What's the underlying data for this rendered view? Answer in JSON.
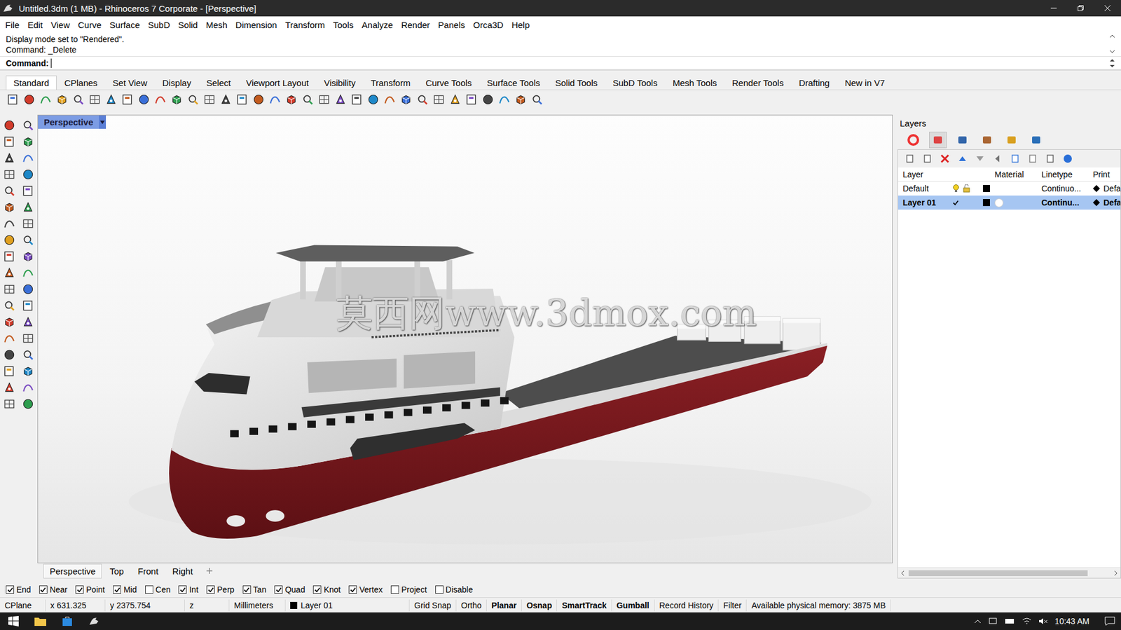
{
  "window": {
    "title": "Untitled.3dm (1 MB) - Rhinoceros 7 Corporate - [Perspective]"
  },
  "menu": [
    "File",
    "Edit",
    "View",
    "Curve",
    "Surface",
    "SubD",
    "Solid",
    "Mesh",
    "Dimension",
    "Transform",
    "Tools",
    "Analyze",
    "Render",
    "Panels",
    "Orca3D",
    "Help"
  ],
  "command": {
    "history": [
      "Display mode set to \"Rendered\".",
      "Command: _Delete"
    ],
    "prompt": "Command:"
  },
  "toolbar_tabs": [
    {
      "label": "Standard",
      "selected": true
    },
    {
      "label": "CPlanes",
      "selected": false
    },
    {
      "label": "Set View",
      "selected": false
    },
    {
      "label": "Display",
      "selected": false
    },
    {
      "label": "Select",
      "selected": false
    },
    {
      "label": "Viewport Layout",
      "selected": false
    },
    {
      "label": "Visibility",
      "selected": false
    },
    {
      "label": "Transform",
      "selected": false
    },
    {
      "label": "Curve Tools",
      "selected": false
    },
    {
      "label": "Surface Tools",
      "selected": false
    },
    {
      "label": "Solid Tools",
      "selected": false
    },
    {
      "label": "SubD Tools",
      "selected": false
    },
    {
      "label": "Mesh Tools",
      "selected": false
    },
    {
      "label": "Render Tools",
      "selected": false
    },
    {
      "label": "Drafting",
      "selected": false
    },
    {
      "label": "New in V7",
      "selected": false
    }
  ],
  "viewport": {
    "title": "Perspective",
    "watermark": "莫西网www.3dmox.com"
  },
  "viewport_tabs": [
    {
      "label": "Perspective",
      "selected": true
    },
    {
      "label": "Top",
      "selected": false
    },
    {
      "label": "Front",
      "selected": false
    },
    {
      "label": "Right",
      "selected": false
    }
  ],
  "layers_panel": {
    "title": "Layers",
    "columns": [
      "Layer",
      "Material",
      "Linetype",
      "Print"
    ],
    "rows": [
      {
        "name": "Default",
        "current": false,
        "selected": false,
        "color": "#000000",
        "has_material": false,
        "linetype": "Continuo...",
        "print": "Defa"
      },
      {
        "name": "Layer 01",
        "current": true,
        "selected": true,
        "color": "#000000",
        "has_material": true,
        "linetype": "Continu...",
        "print": "Defa"
      }
    ],
    "scroll": {
      "level": 0.88
    }
  },
  "osnaps": [
    {
      "label": "End",
      "checked": true
    },
    {
      "label": "Near",
      "checked": true
    },
    {
      "label": "Point",
      "checked": true
    },
    {
      "label": "Mid",
      "checked": true
    },
    {
      "label": "Cen",
      "checked": false
    },
    {
      "label": "Int",
      "checked": true
    },
    {
      "label": "Perp",
      "checked": true
    },
    {
      "label": "Tan",
      "checked": true
    },
    {
      "label": "Quad",
      "checked": true
    },
    {
      "label": "Knot",
      "checked": true
    },
    {
      "label": "Vertex",
      "checked": true
    },
    {
      "label": "Project",
      "checked": false
    },
    {
      "label": "Disable",
      "checked": false
    }
  ],
  "status_bar": {
    "cplane": "CPlane",
    "x": "x 631.325",
    "y": "y 2375.754",
    "z": "z",
    "units": "Millimeters",
    "layer": {
      "name": "Layer 01",
      "color": "#000000"
    },
    "toggles": [
      {
        "label": "Grid Snap",
        "on": false
      },
      {
        "label": "Ortho",
        "on": false
      },
      {
        "label": "Planar",
        "on": true
      },
      {
        "label": "Osnap",
        "on": true
      },
      {
        "label": "SmartTrack",
        "on": true
      },
      {
        "label": "Gumball",
        "on": true
      },
      {
        "label": "Record History",
        "on": false
      },
      {
        "label": "Filter",
        "on": false
      }
    ],
    "memory": "Available physical memory: 3875 MB"
  },
  "taskbar": {
    "time": "10:43 AM"
  }
}
